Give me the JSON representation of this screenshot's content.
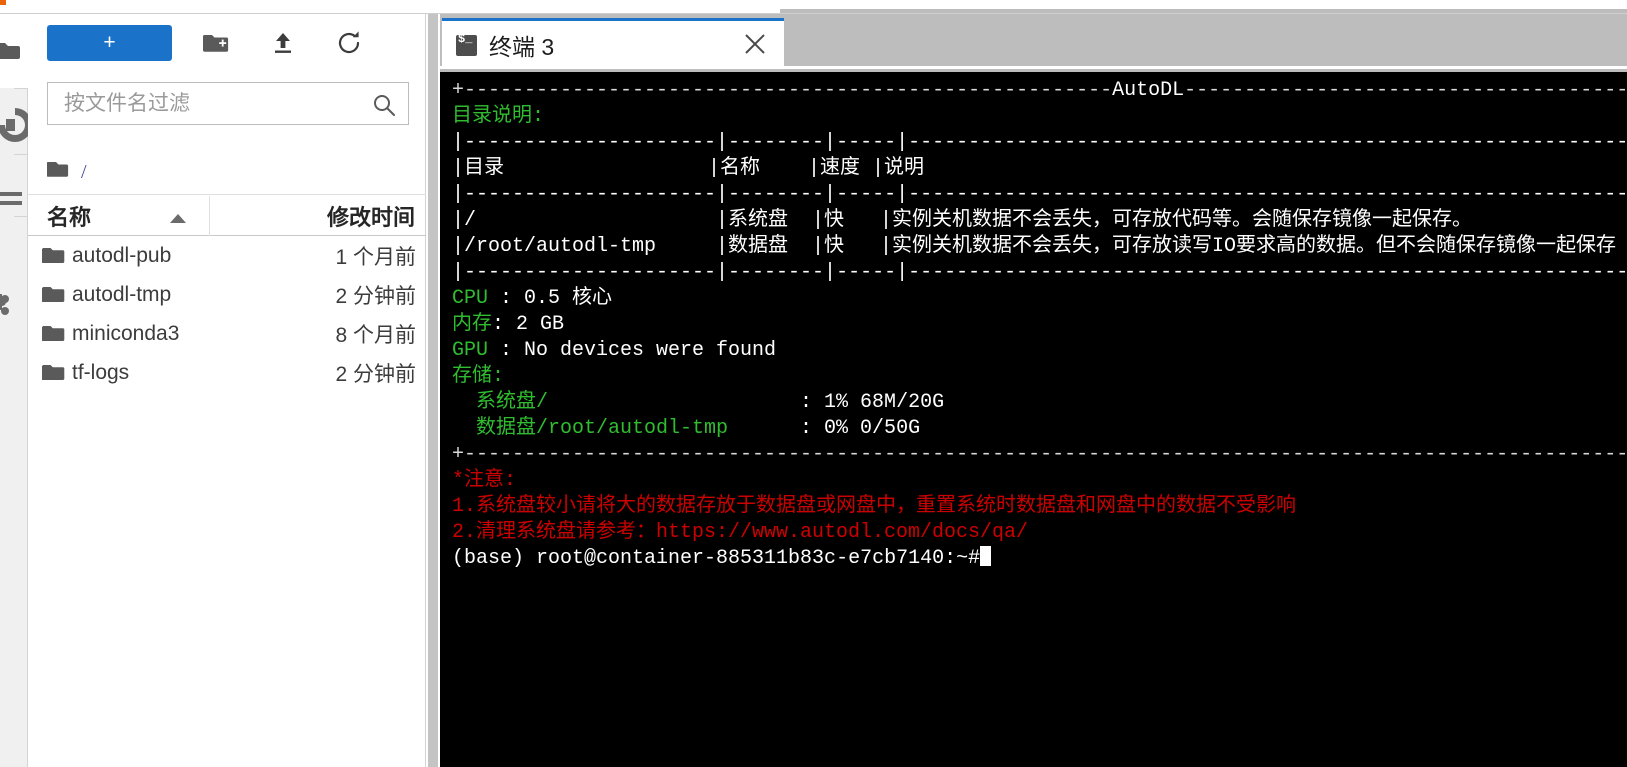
{
  "activity_bar": {
    "items": [
      {
        "name": "file-browser",
        "icon": "folder-icon",
        "selected": true
      },
      {
        "name": "running-terminals",
        "icon": "running-icon",
        "selected": false
      },
      {
        "name": "table-of-contents",
        "icon": "list-icon",
        "selected": false
      },
      {
        "name": "extension-manager",
        "icon": "puzzle-icon",
        "selected": false
      }
    ]
  },
  "file_browser": {
    "toolbar": {
      "new_launcher_label": "+",
      "new_folder_icon": "new-folder-icon",
      "upload_icon": "upload-icon",
      "refresh_icon": "refresh-icon"
    },
    "filter": {
      "placeholder": "按文件名过滤",
      "value": "",
      "icon": "search-icon"
    },
    "breadcrumb": {
      "root_icon": "folder-icon",
      "path": "/"
    },
    "columns": {
      "name": "名称",
      "last_modified": "修改时间",
      "sort_icon": "caret-up-icon"
    },
    "rows": [
      {
        "icon": "folder-icon",
        "name": "autodl-pub",
        "modified": "1 个月前"
      },
      {
        "icon": "folder-icon",
        "name": "autodl-tmp",
        "modified": "2 分钟前"
      },
      {
        "icon": "folder-icon",
        "name": "miniconda3",
        "modified": "8 个月前"
      },
      {
        "icon": "folder-icon",
        "name": "tf-logs",
        "modified": "2 分钟前"
      }
    ]
  },
  "dock": {
    "tabs": [
      {
        "label": "终端 3",
        "icon": "terminal-icon",
        "close_icon": "close-icon",
        "active": true
      }
    ]
  },
  "terminal": {
    "banner_title": "AutoDL",
    "dir_section_label": "目录说明:",
    "dir_table": {
      "headers": [
        "目录",
        "名称",
        "速度",
        "说明"
      ],
      "rows": [
        [
          "/",
          "系统盘",
          "快",
          "实例关机数据不会丢失，可存放代码等。会随保存镜像一起保存。"
        ],
        [
          "/root/autodl-tmp",
          "数据盘",
          "快",
          "实例关机数据不会丢失，可存放读写IO要求高的数据。但不会随保存镜像一起保存"
        ]
      ]
    },
    "specs": [
      {
        "label": "CPU",
        "sep": " : ",
        "value": "0.5 核心"
      },
      {
        "label": "内存",
        "sep": ": ",
        "value": "2 GB"
      },
      {
        "label": "GPU",
        "sep": " : ",
        "value": "No devices were found"
      }
    ],
    "storage_label": "存储:",
    "storage": [
      {
        "label": "系统盘/",
        "value": "1% 68M/20G"
      },
      {
        "label": "数据盘/root/autodl-tmp",
        "value": "0% 0/50G"
      }
    ],
    "notice_label": "*注意:",
    "notices": [
      "1.系统盘较小请将大的数据存放于数据盘或网盘中，重置系统时数据盘和网盘中的数据不受影响",
      "2.清理系统盘请参考：https://www.autodl.com/docs/qa/"
    ],
    "prompt": "(base) root@container-885311b83c-e7cb7140:~#"
  },
  "colors": {
    "accent_blue": "#1a73c8",
    "terminal_bg": "#000000",
    "terminal_green": "#2fbd2f",
    "terminal_red": "#cc0000",
    "terminal_white": "#ffffff",
    "dock_bg": "#bdbdbd"
  }
}
